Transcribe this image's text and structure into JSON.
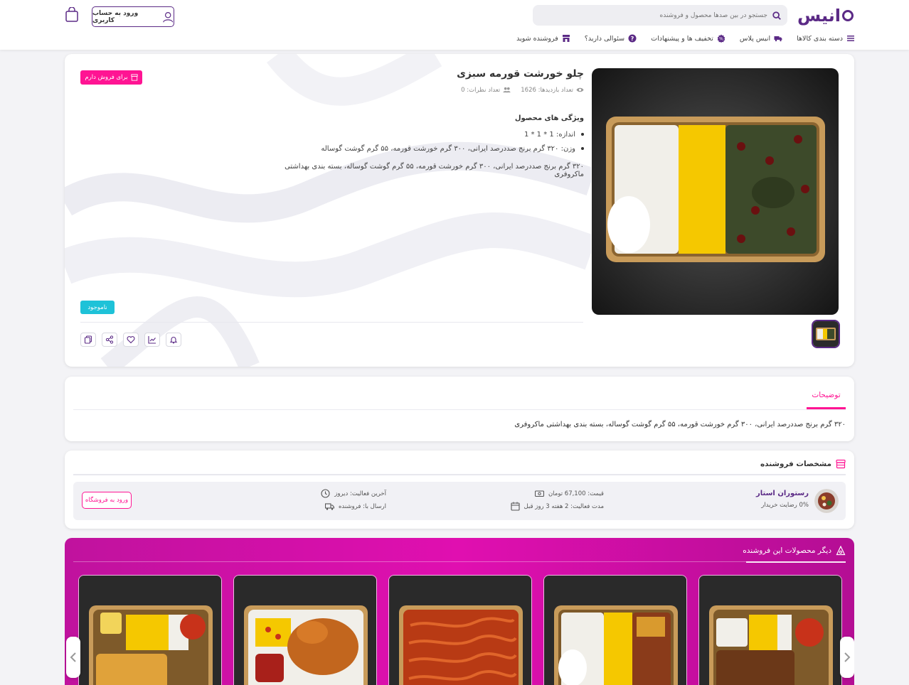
{
  "header": {
    "logo_text": "انیس",
    "search_placeholder": "جستجو در بین صدها محصول و فروشنده",
    "login_label": "ورود به حساب کاربری",
    "nav": [
      {
        "label": "دسته بندی کالاها",
        "icon": "menu-icon"
      },
      {
        "label": "انیس پلاس",
        "icon": "truck-icon"
      },
      {
        "label": "تخفیف ها و پیشنهادات",
        "icon": "discount-icon"
      },
      {
        "label": "سئوالی دارید؟",
        "icon": "question-icon"
      },
      {
        "label": "فروشنده شوید",
        "icon": "store-icon"
      }
    ]
  },
  "product": {
    "title": "چلو خورشت قورمه سبزی",
    "views": "تعداد بازدیدها: 1626",
    "comments": "تعداد نظرات: 0",
    "features_title": "ویژگی های محصول",
    "features": [
      "اندازه: 1 * 1 * 1",
      "وزن: ۳۲۰ گرم برنج صددرصد ایرانی، ۳۰۰ گرم خورشت قورمه، ۵۵ گرم گوشت گوساله"
    ],
    "description": "۳۲۰ گرم برنج صددرصد ایرانی، ۳۰۰ گرم خورشت قورمه، ۵۵ گرم گوشت گوساله، بسته بندی بهداشتی ماکروفری",
    "sell_label": "برای فروش دارم",
    "status": "ناموجود"
  },
  "tabs": {
    "description_tab": "توضیحات",
    "description_text": "۳۲۰ گرم برنج صددرصد ایرانی، ۳۰۰ گرم خورشت قورمه، ۵۵ گرم گوشت گوساله، بسته بندی بهداشتی ماکروفری"
  },
  "seller": {
    "section_title": "مشخصات فروشنده",
    "name": "رستوران استار",
    "satisfaction": "0% رضایت خریدار",
    "price": "قیمت: 67,100 تومان",
    "activity": "مدت فعالیت: 2 هفته 3 روز قبل",
    "last_active": "آخرین فعالیت: دیروز",
    "shipping": "ارسال با: فروشنده",
    "enter_shop": "ورود به فروشگاه"
  },
  "other": {
    "title": "دیگر محصولات این فروشنده"
  },
  "colors": {
    "brand": "#5b2a86",
    "accent": "#ff1493",
    "status": "#1ec2d8"
  }
}
